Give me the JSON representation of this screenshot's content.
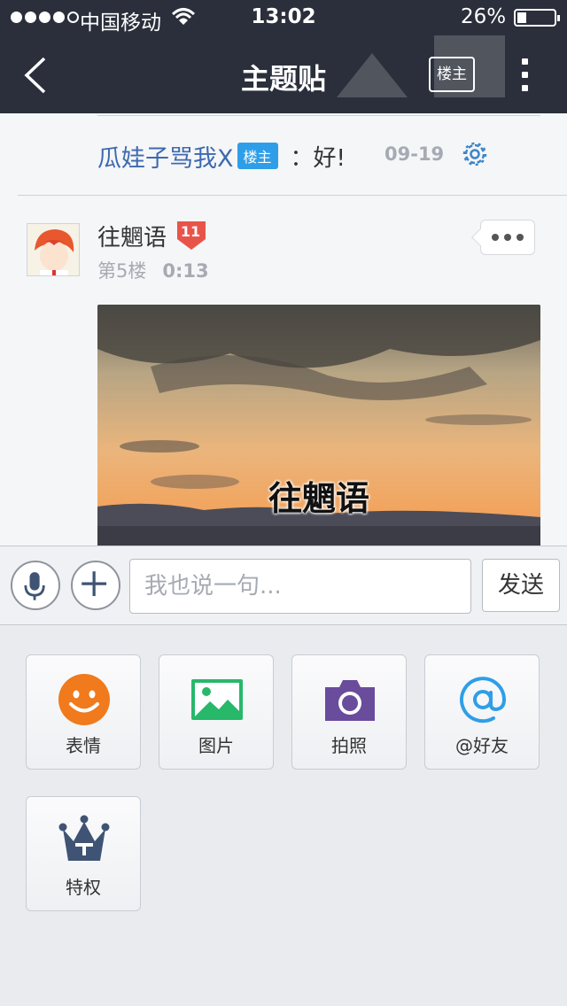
{
  "status_bar": {
    "carrier": "中国移动",
    "time": "13:02",
    "battery": "26%",
    "battery_level": 0.26
  },
  "nav": {
    "title": "主题贴",
    "owner_only_label": "楼主"
  },
  "reply": {
    "user": "瓜娃子骂我X",
    "badge": "楼主",
    "text": "：好!",
    "date": "09-19"
  },
  "post": {
    "user": "往魍语",
    "level": "11",
    "floor": "第5楼",
    "time": "0:13",
    "image_caption": "往魍语"
  },
  "composer": {
    "placeholder": "我也说一句...",
    "send_label": "发送"
  },
  "tools": [
    {
      "label": "表情",
      "icon": "smiley-icon",
      "color": "#f07a1c"
    },
    {
      "label": "图片",
      "icon": "picture-icon",
      "color": "#27b86a"
    },
    {
      "label": "拍照",
      "icon": "camera-icon",
      "color": "#6a4c9c"
    },
    {
      "label": "@好友",
      "icon": "at-icon",
      "color": "#2f9ee8"
    },
    {
      "label": "特权",
      "icon": "crown-icon",
      "color": "#3f5474"
    }
  ],
  "colors": {
    "nav_bg": "#2a2f3b",
    "link_blue": "#3d6ab0",
    "badge_blue": "#2f9ee8",
    "level_red": "#e9544a"
  }
}
